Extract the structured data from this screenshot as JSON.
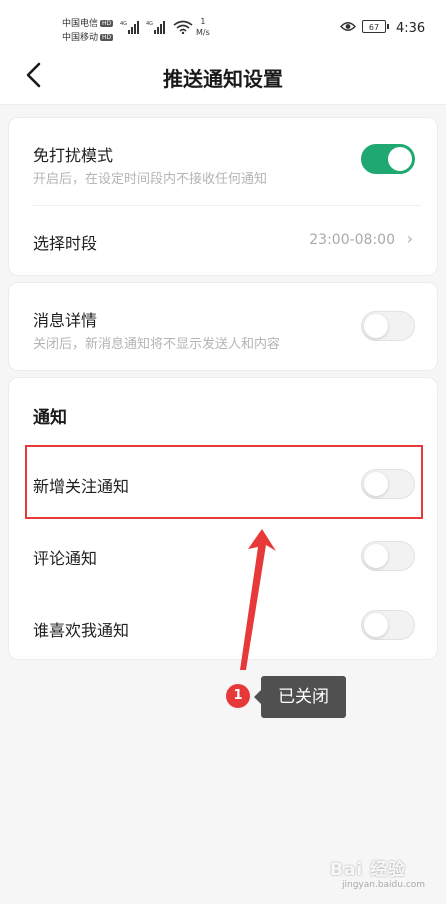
{
  "status_bar": {
    "carrier1": "中国电信",
    "carrier2": "中国移动",
    "hd": "HD",
    "speed_value": "1",
    "speed_unit": "M/s",
    "battery": "67",
    "time": "4:36"
  },
  "header": {
    "title": "推送通知设置",
    "back_icon": "chevron-left-icon"
  },
  "dnd_card": {
    "dnd_label": "免打扰模式",
    "dnd_desc": "开启后，在设定时间段内不接收任何通知",
    "dnd_enabled": true,
    "period_label": "选择时段",
    "period_value": "23:00-08:00"
  },
  "detail_card": {
    "label": "消息详情",
    "desc": "关闭后，新消息通知将不显示发送人和内容",
    "enabled": false
  },
  "notify_card": {
    "section_title": "通知",
    "items": [
      {
        "label": "新增关注通知",
        "enabled": false
      },
      {
        "label": "评论通知",
        "enabled": false
      },
      {
        "label": "谁喜欢我通知",
        "enabled": false
      }
    ]
  },
  "annotation": {
    "badge_number": "1",
    "callout_text": "已关闭",
    "accent_color": "#e8393a"
  },
  "colors": {
    "switch_on": "#1fa971",
    "switch_off": "#f2f2f2"
  },
  "watermark": {
    "text": "Bai 经验",
    "domain": "jingyan.baidu.com"
  }
}
